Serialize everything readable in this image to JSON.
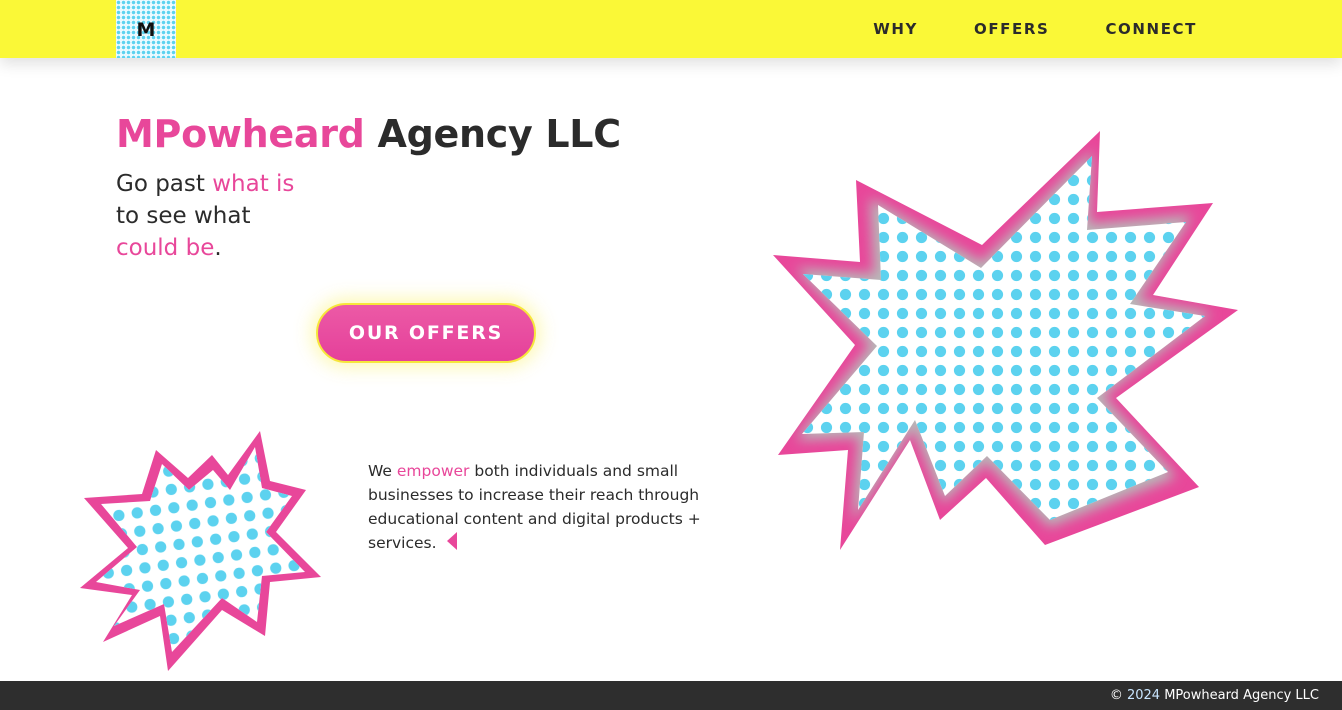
{
  "header": {
    "logo_letter": "M",
    "nav": [
      {
        "label": "WHY"
      },
      {
        "label": "OFFERS"
      },
      {
        "label": "CONNECT"
      }
    ]
  },
  "hero": {
    "title_highlight": "MPowheard",
    "title_rest": " Agency LLC",
    "tagline": {
      "part1": "Go past ",
      "highlight1": "what is",
      "part2": "to see what",
      "highlight2": "could be",
      "end": "."
    },
    "cta_label": "OUR OFFERS"
  },
  "about": {
    "text_start": "We ",
    "highlight": "empower",
    "text_end": " both individuals and small businesses to increase their reach through educational content and digital products + services."
  },
  "footer": {
    "copyright_symbol": "©",
    "year": "2024",
    "company": "MPowheard Agency LLC"
  },
  "colors": {
    "brand_yellow": "#faf837",
    "brand_pink": "#e8479a",
    "dot_blue": "#5cd2ef",
    "footer_bg": "#2e2e2e"
  },
  "icons": {
    "large_burst": "comic-burst-icon",
    "small_burst": "comic-burst-icon",
    "pointer": "triangle-left-icon"
  }
}
